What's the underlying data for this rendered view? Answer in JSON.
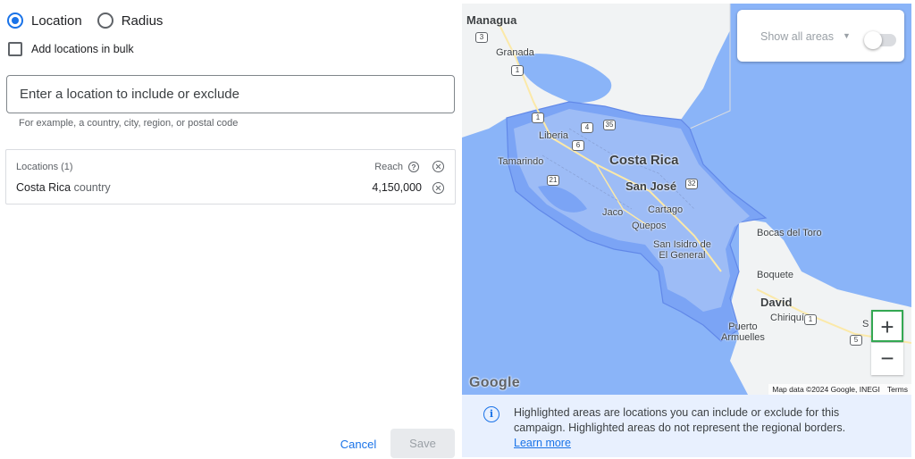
{
  "location_mode": {
    "options": [
      {
        "label": "Location",
        "selected": true
      },
      {
        "label": "Radius",
        "selected": false
      }
    ]
  },
  "bulk": {
    "label": "Add locations in bulk",
    "checked": false
  },
  "search": {
    "placeholder": "Enter a location to include or exclude",
    "value": "",
    "hint": "For example, a country, city, region, or postal code"
  },
  "locations_card": {
    "header": "Locations (1)",
    "reach_header": "Reach",
    "help_glyph": "?",
    "rows": [
      {
        "name": "Costa Rica",
        "type": "country",
        "reach": "4,150,000"
      }
    ]
  },
  "actions": {
    "cancel": "Cancel",
    "save": "Save"
  },
  "map": {
    "show_all_areas": {
      "label": "Show all areas",
      "enabled": false
    },
    "zoom_in": "+",
    "zoom_out": "−",
    "logo": "Google",
    "attribution": "Map data ©2024 Google, INEGI",
    "terms": "Terms",
    "country_label": "Costa Rica",
    "capital_label": "San José",
    "place_labels": {
      "managua": "Managua",
      "granada": "Granada",
      "liberia": "Liberia",
      "tamarindo": "Tamarindo",
      "jaco": "Jaco",
      "cartago": "Cartago",
      "quepos": "Quepos",
      "san_isidro": "San Isidro de\nEl General",
      "bocas": "Bocas del Toro",
      "boquete": "Boquete",
      "david": "David",
      "chiriqui": "Chiriquí",
      "puerto": "Puerto\nArmuelles",
      "s": "S"
    },
    "route_shields": [
      "3",
      "1",
      "1",
      "4",
      "35",
      "6",
      "21",
      "32",
      "1",
      "5"
    ]
  },
  "info": {
    "text": "Highlighted areas are locations you can include or exclude for this campaign. Highlighted areas do not represent the regional borders.",
    "link": "Learn more"
  },
  "colors": {
    "accent": "#1a73e8",
    "water": "#8ab4f8",
    "land": "#f1f3f4",
    "highlight": "#7ba4f5",
    "info_bg": "#e8f0fe"
  }
}
